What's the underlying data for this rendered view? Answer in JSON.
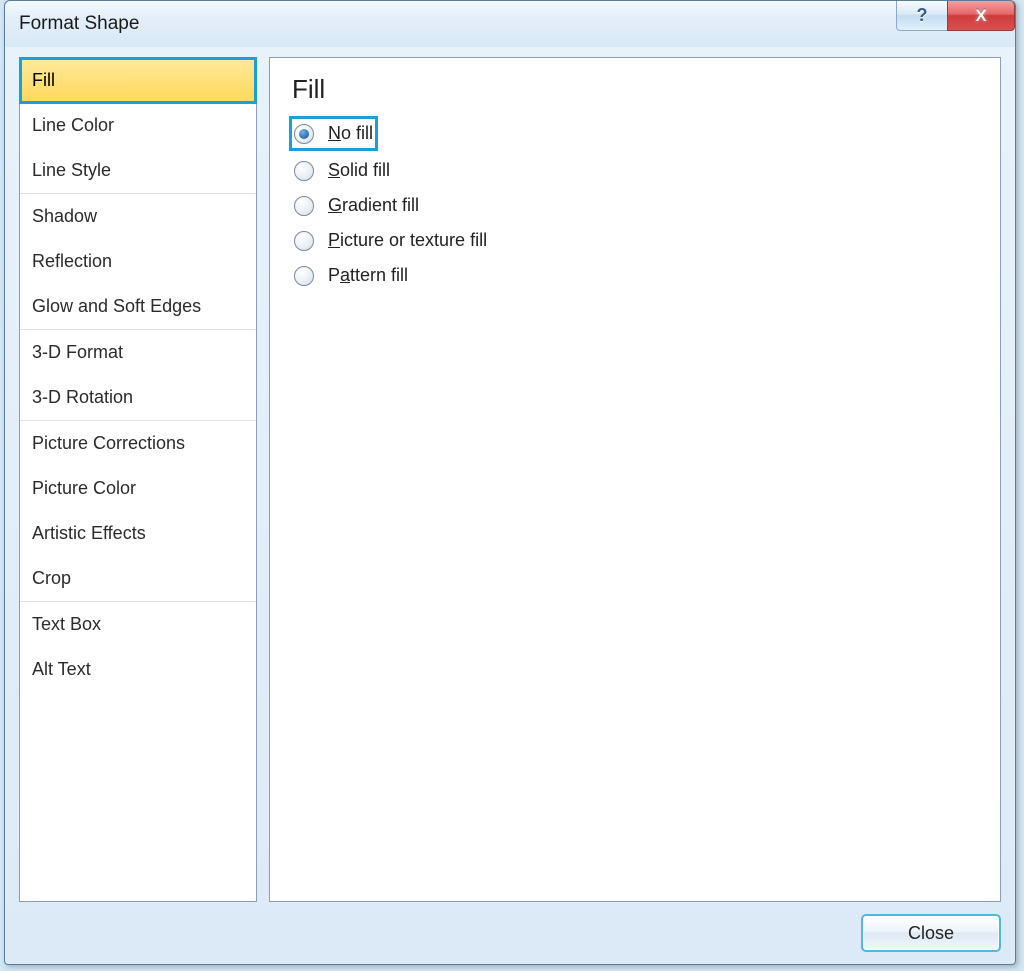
{
  "titlebar": {
    "title": "Format Shape",
    "help_symbol": "?",
    "close_symbol": "X"
  },
  "sidebar": {
    "groups": [
      {
        "items": [
          {
            "label": "Fill",
            "selected": true
          },
          {
            "label": "Line Color"
          },
          {
            "label": "Line Style"
          }
        ]
      },
      {
        "items": [
          {
            "label": "Shadow"
          },
          {
            "label": "Reflection"
          },
          {
            "label": "Glow and Soft Edges"
          }
        ]
      },
      {
        "items": [
          {
            "label": "3-D Format"
          },
          {
            "label": "3-D Rotation"
          }
        ]
      },
      {
        "items": [
          {
            "label": "Picture Corrections"
          },
          {
            "label": "Picture Color"
          },
          {
            "label": "Artistic Effects"
          },
          {
            "label": "Crop"
          }
        ]
      },
      {
        "items": [
          {
            "label": "Text Box"
          },
          {
            "label": "Alt Text"
          }
        ]
      }
    ]
  },
  "main": {
    "heading": "Fill",
    "options": [
      {
        "label_html": "<span class='ul'>N</span>o fill",
        "checked": true,
        "highlighted": true
      },
      {
        "label_html": "<span class='ul'>S</span>olid fill"
      },
      {
        "label_html": "<span class='ul'>G</span>radient fill"
      },
      {
        "label_html": "<span class='ul'>P</span>icture or texture fill"
      },
      {
        "label_html": "P<span class='ul'>a</span>ttern fill"
      }
    ]
  },
  "footer": {
    "close_label": "Close"
  }
}
